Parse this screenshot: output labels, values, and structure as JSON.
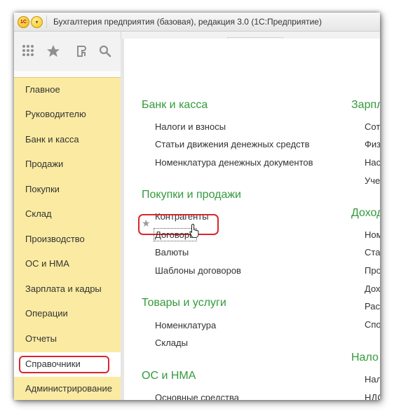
{
  "window": {
    "title": "Бухгалтерия предприятия (базовая), редакция 3.0  (1С:Предприятие)",
    "logo_text": "1С"
  },
  "toolbar": {
    "icons": [
      "apps-grid-icon",
      "star-icon",
      "history-icon",
      "search-icon"
    ]
  },
  "sidebar": {
    "items": [
      {
        "label": "Главное"
      },
      {
        "label": "Руководителю"
      },
      {
        "label": "Банк и касса"
      },
      {
        "label": "Продажи"
      },
      {
        "label": "Покупки"
      },
      {
        "label": "Склад"
      },
      {
        "label": "Производство"
      },
      {
        "label": "ОС и НМА"
      },
      {
        "label": "Зарплата и кадры"
      },
      {
        "label": "Операции"
      },
      {
        "label": "Отчеты"
      },
      {
        "label": "Справочники"
      },
      {
        "label": "Администрирование"
      }
    ],
    "active_item": "Справочники",
    "highlight_color": "#d9262c",
    "background_color": "#fbeba2"
  },
  "main": {
    "column1": {
      "sections": [
        {
          "title": "Банк и касса",
          "links": [
            "Налоги и взносы",
            "Статьи движения денежных средств",
            "Номенклатура денежных документов"
          ]
        },
        {
          "title": "Покупки и продажи",
          "links": [
            "Контрагенты",
            "Договоры",
            "Валюты",
            "Шаблоны договоров"
          ]
        },
        {
          "title": "Товары и услуги",
          "links": [
            "Номенклатура",
            "Склады"
          ]
        },
        {
          "title": "ОС и НМА",
          "links": [
            "Основные средства"
          ]
        }
      ]
    },
    "column2": {
      "sections": [
        {
          "title": "Зарпл",
          "links": [
            "Сот",
            "Физ",
            "Нас",
            "Уче"
          ]
        },
        {
          "title": "Доход",
          "links": [
            "Ном",
            "Ста",
            "Про",
            "Дох",
            "Рас",
            "Спо"
          ]
        },
        {
          "title": "Нало",
          "links": [
            "Нал",
            "НДС"
          ]
        }
      ]
    },
    "section_title_color": "#339a3b",
    "highlighted_link": "Договоры"
  }
}
